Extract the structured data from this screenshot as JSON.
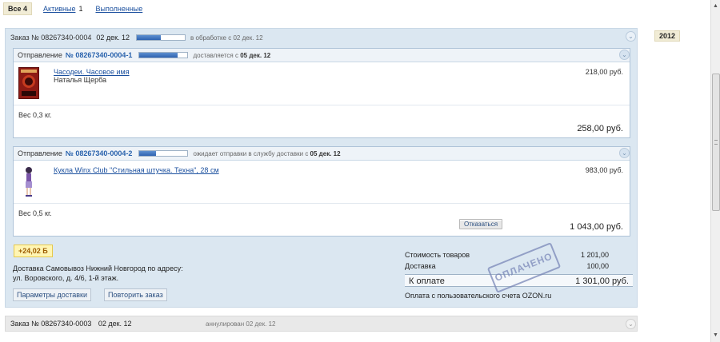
{
  "filters": {
    "all_label": "Все 4",
    "active_label": "Активные",
    "active_count": "1",
    "done_label": "Выполненные"
  },
  "year": "2012",
  "order": {
    "title": "Заказ  № 08267340-0004",
    "date": "02 дек. 12",
    "progress": 0.5,
    "status": "в обработке с 02 дек. 12",
    "shipments": [
      {
        "label": "Отправление",
        "number": "№ 08267340-0004-1",
        "progress": 0.8,
        "status_prefix": "доставляется с",
        "status_date": "05 дек. 12",
        "item_title": "Часодеи. Часовое имя",
        "item_author": "Наталья Щерба",
        "item_price": "218,00 руб.",
        "weight": "Вес 0,3 кг.",
        "total": "258,00 руб."
      },
      {
        "label": "Отправление",
        "number": "№ 08267340-0004-2",
        "progress": 0.35,
        "status_prefix": "ожидает отправки в службу доставки с",
        "status_date": "05 дек. 12",
        "item_title": "Кукла Winx Club \"Стильная штучка. Техна\", 28 см",
        "item_price": "983,00 руб.",
        "weight": "Вес 0,5 кг.",
        "cancel_label": "Отказаться",
        "total": "1 043,00 руб."
      }
    ],
    "bonus": "+24,02 Б",
    "delivery_line1": "Доставка Самовывоз Нижний Новгород по адресу:",
    "delivery_line2": "ул. Воровского, д. 4/6, 1-й этаж.",
    "delivery_params_label": "Параметры доставки",
    "repeat_label": "Повторить заказ",
    "summary": {
      "goods_label": "Стоимость товаров",
      "goods_value": "1 201,00",
      "delivery_label": "Доставка",
      "delivery_value": "100,00",
      "total_label": "К оплате",
      "total_value": "1 301,00 руб.",
      "paid_note": "Оплата с пользовательского счета OZON.ru"
    },
    "stamp": "ОПЛАЧЕНО"
  },
  "order2": {
    "title": "Заказ  № 08267340-0003",
    "date": "02 дек. 12",
    "status": "аннулирован 02 дек. 12"
  }
}
